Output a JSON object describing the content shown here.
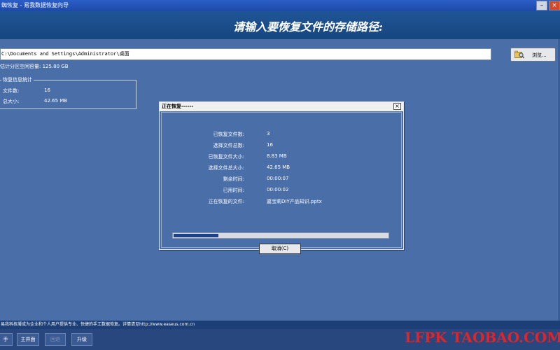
{
  "window": {
    "title": "蜘恢复 - 易我数据恢复向导"
  },
  "header": {
    "prompt": "请输入要恢复文件的存储路径:"
  },
  "path": {
    "value": "C:\\Documents and Settings\\Administrator\\桌面"
  },
  "browse": {
    "label": "浏览..."
  },
  "capacity": {
    "text": "估计分区空闲容量: 125.80 GB"
  },
  "stats": {
    "legend": "恢复信息统计",
    "files_label": "文件数:",
    "files_value": "16",
    "size_label": "总大小:",
    "size_value": "42.65 MB"
  },
  "dialog": {
    "title": "正在恢复------",
    "close": "×",
    "rows": [
      {
        "label": "已恢复文件数:",
        "value": "3"
      },
      {
        "label": "选择文件总数:",
        "value": "16"
      },
      {
        "label": "已恢复文件大小:",
        "value": "8.83 MB"
      },
      {
        "label": "选择文件总大小:",
        "value": "42.65 MB"
      },
      {
        "label": "剩余时间:",
        "value": "00:00:07"
      },
      {
        "label": "已用时间:",
        "value": "00:00:02"
      },
      {
        "label": "正在恢复的文件:",
        "value": "嘉宝莉DIY产品知识.pptx"
      }
    ],
    "progress": 0.21,
    "cancel_label": "取消(C)"
  },
  "status": {
    "text": "易我科技凝成为企业和个人用户提供专业、快捷的手工数据恢复。详情请见http://www.easeus.com.cn"
  },
  "nav": {
    "help": "手",
    "main": "主界面",
    "back": "回退",
    "upgrade": "升级"
  },
  "watermark": {
    "text": "LFPK TAOBAO.COM"
  },
  "colors": {
    "background": "#4a6ea8",
    "header": "#1f5597",
    "progress_fill": "#1e3f8a",
    "watermark": "#e0252a"
  }
}
